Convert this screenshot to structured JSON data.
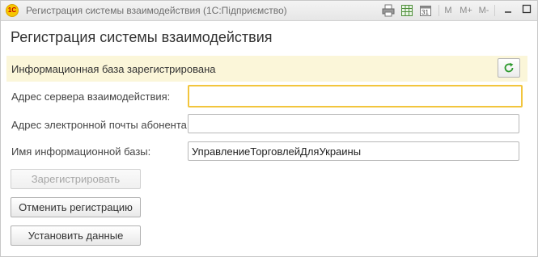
{
  "window": {
    "title": "Регистрация системы взаимодействия  (1С:Підприємство)",
    "app_logo": "1С",
    "toolbar": {
      "icons": [
        "print-icon",
        "spreadsheet-icon",
        "calendar-icon",
        "memory-icon",
        "memory-plus-icon",
        "memory-minus-icon"
      ],
      "calendar_day": "31",
      "m_label": "M",
      "m_plus_label": "M+",
      "m_minus_label": "M-"
    },
    "controls": {
      "minimize": "—",
      "maximize": "☐",
      "close": "✕"
    }
  },
  "form": {
    "title": "Регистрация системы взаимодействия",
    "info_message": "Информационная база зарегистрирована",
    "fields": [
      {
        "label": "Адрес сервера взаимодействия:",
        "value": ""
      },
      {
        "label": "Адрес электронной почты абонента:",
        "value": ""
      },
      {
        "label": "Имя информационной базы:",
        "value": "УправлениеТорговлейДляУкраины"
      }
    ],
    "buttons": {
      "register": "Зарегистрировать",
      "cancel_registration": "Отменить регистрацию",
      "set_data": "Установить данные"
    }
  },
  "colors": {
    "info_bar": "#fbf6d9",
    "focus_border": "#f2c53d",
    "refresh_icon": "#2e9a2e"
  }
}
